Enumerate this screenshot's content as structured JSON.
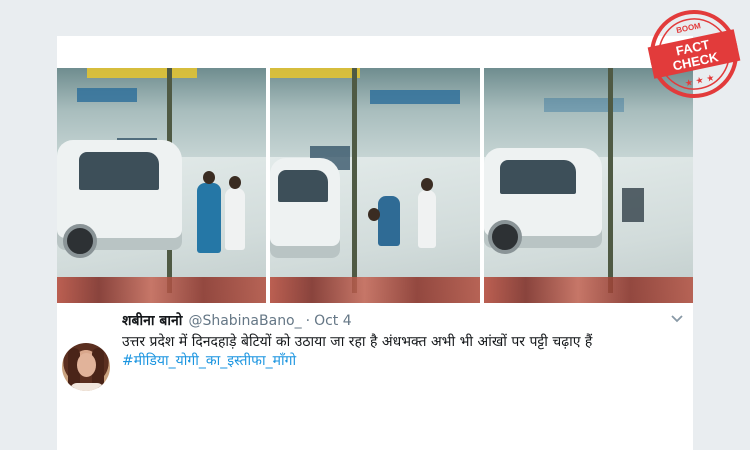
{
  "tweet": {
    "display_name": "शबीना बानो",
    "handle": "@ShabinaBano_",
    "separator": "·",
    "date": "Oct 4",
    "text": "उत्तर प्रदेश में दिनदहाड़े बेटियों को उठाया जा रहा है  अंधभक्त अभी भी आंखों पर पट्टी चढ़ाए हैं",
    "hashtag": "#मीडिया_योगी_का_इस्तीफा_माँगो",
    "caret_icon": "chevron-down-icon"
  },
  "stamp": {
    "brand": "BOOM",
    "line1": "FACT",
    "line2": "CHECK",
    "stars": "★ ★ ★",
    "color": "#e23b3b"
  },
  "media": {
    "frames": [
      "cctv-frame-1",
      "cctv-frame-2",
      "cctv-frame-3"
    ]
  }
}
